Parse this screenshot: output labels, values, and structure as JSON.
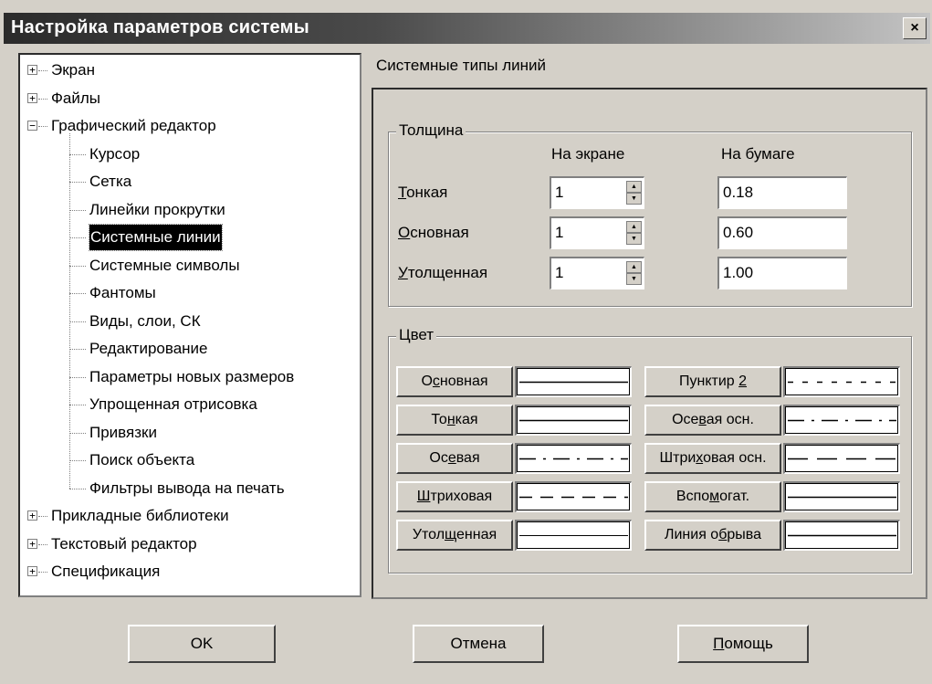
{
  "window": {
    "title": "Настройка параметров системы",
    "close_glyph": "×"
  },
  "tree": {
    "items": [
      {
        "label": "Экран",
        "level": 0,
        "expander": "+"
      },
      {
        "label": "Файлы",
        "level": 0,
        "expander": "+"
      },
      {
        "label": "Графический редактор",
        "level": 0,
        "expander": "−"
      },
      {
        "label": "Курсор",
        "level": 1
      },
      {
        "label": "Сетка",
        "level": 1
      },
      {
        "label": "Линейки прокрутки",
        "level": 1
      },
      {
        "label": "Системные линии",
        "level": 1,
        "selected": true
      },
      {
        "label": "Системные символы",
        "level": 1
      },
      {
        "label": "Фантомы",
        "level": 1
      },
      {
        "label": "Виды, слои, СК",
        "level": 1
      },
      {
        "label": "Редактирование",
        "level": 1
      },
      {
        "label": "Параметры новых размеров",
        "level": 1
      },
      {
        "label": "Упрощенная отрисовка",
        "level": 1
      },
      {
        "label": "Привязки",
        "level": 1
      },
      {
        "label": "Поиск объекта",
        "level": 1
      },
      {
        "label": "Фильтры вывода на печать",
        "level": 1
      },
      {
        "label": "Прикладные библиотеки",
        "level": 0,
        "expander": "+"
      },
      {
        "label": "Текстовый редактор",
        "level": 0,
        "expander": "+"
      },
      {
        "label": "Спецификация",
        "level": 0,
        "expander": "+"
      }
    ]
  },
  "panel": {
    "header": "Системные типы линий",
    "thickness": {
      "title": "Толщина",
      "col_screen": "На экране",
      "col_paper": "На бумаге",
      "rows": [
        {
          "ul": "Т",
          "rest": "онкая",
          "screen": "1",
          "paper": "0.18"
        },
        {
          "ul": "О",
          "rest": "сновная",
          "screen": "1",
          "paper": "0.60"
        },
        {
          "ul": "У",
          "rest": "толщенная",
          "screen": "1",
          "paper": "1.00"
        }
      ]
    },
    "color": {
      "title": "Цвет",
      "left": [
        {
          "pre": "О",
          "ul": "с",
          "post": "новная",
          "line": "solid"
        },
        {
          "pre": "То",
          "ul": "н",
          "post": "кая",
          "line": "solid"
        },
        {
          "pre": "Ос",
          "ul": "е",
          "post": "вая",
          "line": "dashdot"
        },
        {
          "pre": "",
          "ul": "Ш",
          "post": "триховая",
          "line": "dashed"
        },
        {
          "pre": "Утол",
          "ul": "щ",
          "post": "енная",
          "line": "thin"
        }
      ],
      "right": [
        {
          "pre": "Пунктир ",
          "ul": "2",
          "post": "",
          "line": "dashed-short"
        },
        {
          "pre": "Осе",
          "ul": "в",
          "post": "ая осн.",
          "line": "dashdot"
        },
        {
          "pre": "Штри",
          "ul": "х",
          "post": "овая осн.",
          "line": "dashed-long"
        },
        {
          "pre": "Вспо",
          "ul": "м",
          "post": "огат.",
          "line": "solid"
        },
        {
          "pre": "Линия о",
          "ul": "б",
          "post": "рыва",
          "line": "solid"
        }
      ]
    }
  },
  "buttons": {
    "ok": "OK",
    "cancel": "Отмена",
    "help_ul": "П",
    "help_rest": "омощь"
  }
}
